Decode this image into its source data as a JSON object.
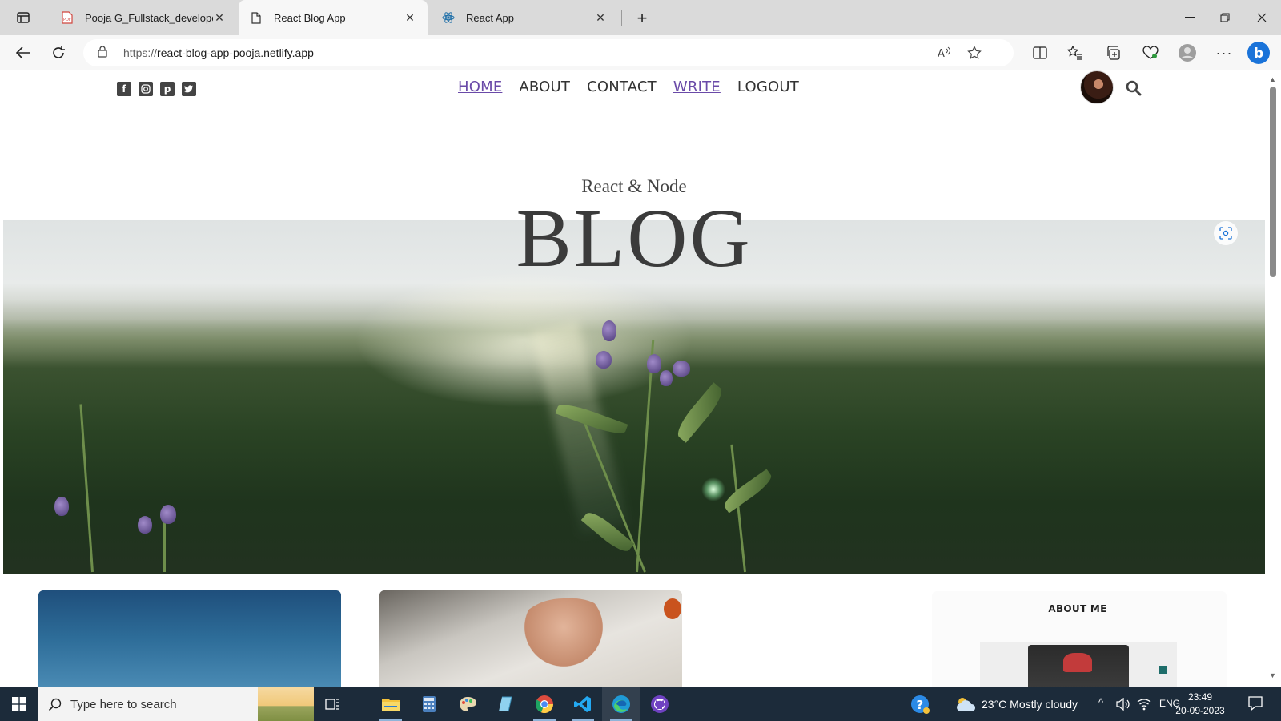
{
  "browser": {
    "tabs": [
      {
        "title": "Pooja G_Fullstack_develope",
        "favicon": "pdf-icon",
        "active": false
      },
      {
        "title": "React Blog App",
        "favicon": "page-icon",
        "active": true
      },
      {
        "title": "React App",
        "favicon": "react-icon",
        "active": false
      }
    ],
    "url_prefix": "https://",
    "url_host": "react-blog-app-pooja.netlify.app"
  },
  "blog": {
    "social": [
      "facebook-icon",
      "instagram-icon",
      "pinterest-icon",
      "twitter-icon"
    ],
    "nav": [
      "HOME",
      "ABOUT",
      "CONTACT",
      "WRITE",
      "LOGOUT"
    ],
    "subtitle": "React & Node",
    "title": "BLOG",
    "sidebar_title": "ABOUT ME",
    "link_color": "#6a4aa8"
  },
  "taskbar": {
    "search_placeholder": "Type here to search",
    "weather": "23°C  Mostly cloudy",
    "lang": "ENG",
    "time": "23:49",
    "date": "20-09-2023"
  }
}
